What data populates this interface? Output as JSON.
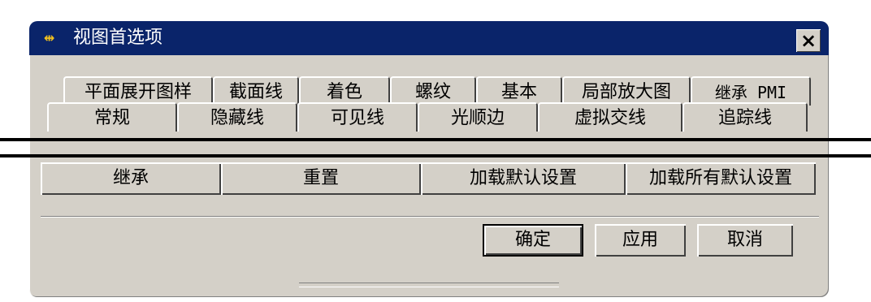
{
  "window": {
    "title": "视图首选项",
    "close_label": "×",
    "icon": "app-icon"
  },
  "tabs_row1": [
    {
      "label": "平面展开图样"
    },
    {
      "label": "截面线"
    },
    {
      "label": "着色"
    },
    {
      "label": "螺纹"
    },
    {
      "label": "基本"
    },
    {
      "label": "局部放大图"
    },
    {
      "label": "继承 PMI"
    }
  ],
  "tabs_row2": [
    {
      "label": "常规"
    },
    {
      "label": "隐藏线"
    },
    {
      "label": "可见线"
    },
    {
      "label": "光顺边"
    },
    {
      "label": "虚拟交线"
    },
    {
      "label": "追踪线"
    }
  ],
  "settings_buttons": {
    "inherit": "继承",
    "reset": "重置",
    "load_default": "加载默认设置",
    "load_all_default": "加载所有默认设置"
  },
  "dialog_buttons": {
    "ok": "确定",
    "apply": "应用",
    "cancel": "取消"
  },
  "colors": {
    "titlebar": "#0a246a",
    "face": "#d4d0c8"
  }
}
